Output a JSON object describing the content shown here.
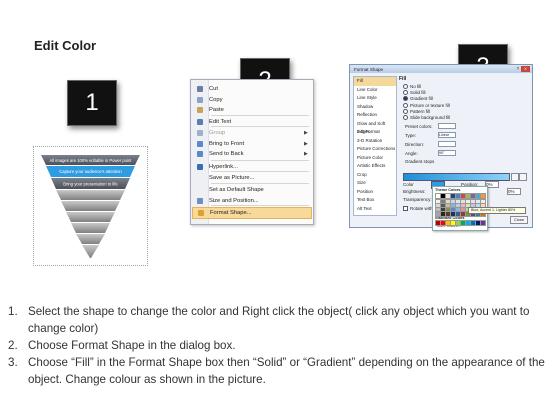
{
  "page": {
    "title": "Edit Color"
  },
  "badges": [
    "1",
    "2",
    "3"
  ],
  "pyramid": {
    "line1": "All images are 100% editable in Power point",
    "line2": "Capture your audience's attention",
    "line3": "Bring your presentation to life",
    "colors": {
      "top": "#5d6470",
      "highlight": "#2f9be0",
      "band": "#8a8a8a"
    }
  },
  "context_menu": {
    "items": [
      {
        "label": "Cut",
        "icon": "scissors-icon",
        "disabled": false,
        "submenu": false
      },
      {
        "label": "Copy",
        "icon": "copy-icon",
        "disabled": false,
        "submenu": false
      },
      {
        "label": "Paste",
        "icon": "paste-icon",
        "disabled": false,
        "submenu": false
      },
      {
        "label": "Edit Text",
        "icon": "edit-text-icon",
        "disabled": false,
        "submenu": false
      },
      {
        "label": "Group",
        "icon": "group-icon",
        "disabled": true,
        "submenu": true
      },
      {
        "label": "Bring to Front",
        "icon": "bring-front-icon",
        "disabled": false,
        "submenu": true
      },
      {
        "label": "Send to Back",
        "icon": "send-back-icon",
        "disabled": false,
        "submenu": true
      },
      {
        "label": "Hyperlink...",
        "icon": "hyperlink-icon",
        "disabled": false,
        "submenu": false
      },
      {
        "label": "Save as Picture...",
        "icon": "",
        "disabled": false,
        "submenu": false
      },
      {
        "label": "Set as Default Shape",
        "icon": "",
        "disabled": false,
        "submenu": false
      },
      {
        "label": "Size and Position...",
        "icon": "size-icon",
        "disabled": false,
        "submenu": false
      },
      {
        "label": "Format Shape...",
        "icon": "format-shape-icon",
        "disabled": false,
        "submenu": false,
        "selected": true
      }
    ]
  },
  "format_dialog": {
    "title": "Format Shape",
    "help": "?",
    "close": "X",
    "categories": [
      "Fill",
      "Line Color",
      "Line Style",
      "Shadow",
      "Reflection",
      "Glow and Soft Edges",
      "3-D Format",
      "3-D Rotation",
      "Picture Corrections",
      "Picture Color",
      "Artistic Effects",
      "Crop",
      "Size",
      "Position",
      "Text Box",
      "Alt Text"
    ],
    "selected_category": "Fill",
    "fill_heading": "Fill",
    "fill_options": [
      "No fill",
      "Solid fill",
      "Gradient fill",
      "Picture or texture fill",
      "Pattern fill",
      "Slide background fill"
    ],
    "selected_fill": "Gradient fill",
    "fields": [
      {
        "label": "Preset colors:",
        "value": ""
      },
      {
        "label": "Type:",
        "value": "Linear"
      },
      {
        "label": "Direction:",
        "value": ""
      },
      {
        "label": "Angle:",
        "value": "90°"
      },
      {
        "label": "Gradient stops",
        "value": ""
      }
    ],
    "color_label": "Color",
    "brightness_label": "Brightness:",
    "transparency_label": "Transparency:",
    "position_label": "Position:",
    "position_value": "0%",
    "brightness_value": "0%",
    "rotate_label": "Rotate with shape",
    "theme_colors_label": "Theme Colors",
    "standard_colors_label": "Standard Colors",
    "more_colors": "More Colors...",
    "tooltip": "Blue, Accent 1, Lighter 80%",
    "close_button": "Close"
  },
  "instructions": [
    {
      "num": "1.",
      "text": "Select the shape to change the color and Right click the object( click any object which you want to change color)"
    },
    {
      "num": "2.",
      "text": "Choose Format Shape in the dialog box."
    },
    {
      "num": "3.",
      "text": "Choose “Fill” in the Format Shape box then “Solid” or “Gradient” depending on the appearance of the object. Change colour as shown in the picture."
    }
  ]
}
